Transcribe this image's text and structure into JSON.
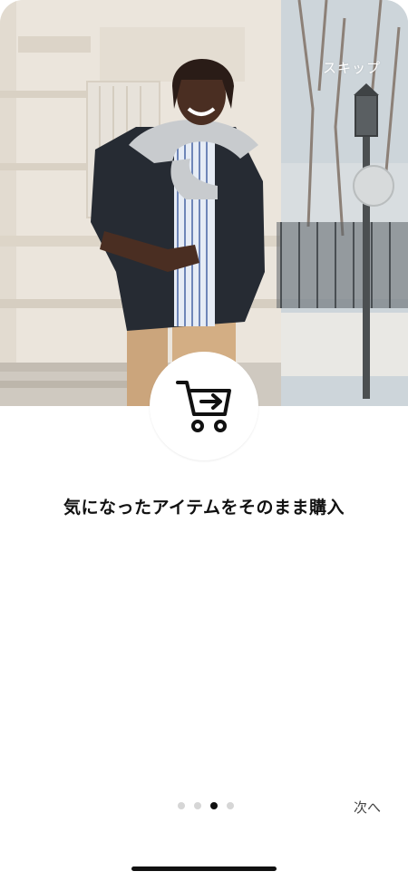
{
  "hero": {
    "skip_label": "スキップ",
    "image_icon": "fashion-photo"
  },
  "badge": {
    "icon": "cart-arrow-icon"
  },
  "title": "気になったアイテムをそのまま購入",
  "pager": {
    "total": 4,
    "current": 3
  },
  "next_label": "次へ",
  "colors": {
    "accent": "#111111",
    "inactive_dot": "#d6d6d6",
    "background": "#ffffff"
  }
}
